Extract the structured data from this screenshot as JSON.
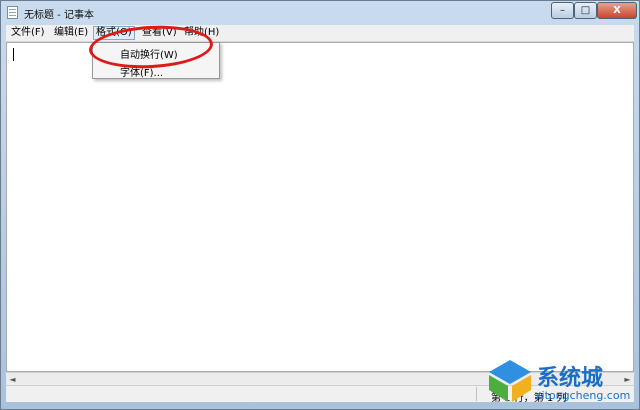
{
  "window": {
    "title": "无标题 - 记事本"
  },
  "controls": {
    "minimize": "–",
    "maximize": "□",
    "close": "X"
  },
  "menubar": {
    "items": [
      {
        "label": "文件(F)"
      },
      {
        "label": "编辑(E)"
      },
      {
        "label": "格式(O)"
      },
      {
        "label": "查看(V)"
      },
      {
        "label": "帮助(H)"
      }
    ]
  },
  "format_menu": {
    "items": [
      {
        "label": "自动换行(W)"
      },
      {
        "label": "字体(F)..."
      }
    ]
  },
  "editor": {
    "content": ""
  },
  "scrollbar": {
    "left_arrow": "◄",
    "right_arrow": "►"
  },
  "statusbar": {
    "position": "第 1 行，第 1 列"
  },
  "watermark": {
    "brand": "系统城",
    "site": "xitongcheng.com"
  },
  "colors": {
    "highlight": "#e01818",
    "watermark": "#1a6fc4"
  }
}
